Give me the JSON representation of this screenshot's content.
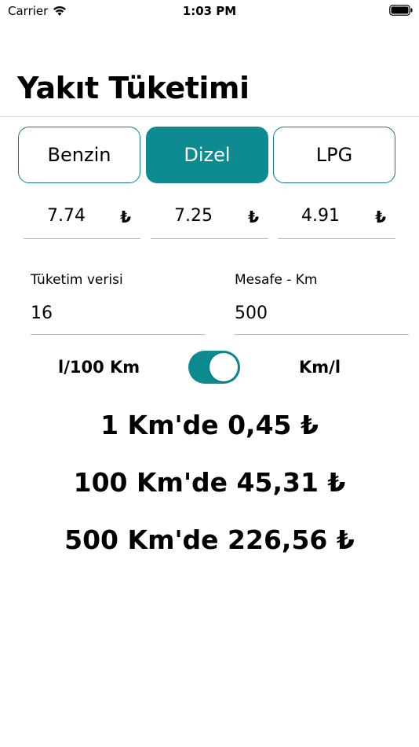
{
  "status": {
    "carrier": "Carrier",
    "time": "1:03 PM"
  },
  "header": {
    "title": "Yakıt Tüketimi"
  },
  "fuel_tabs": [
    {
      "label": "Benzin",
      "active": false
    },
    {
      "label": "Dizel",
      "active": true
    },
    {
      "label": "LPG",
      "active": false
    }
  ],
  "prices": [
    {
      "value": "7.74",
      "currency": "₺"
    },
    {
      "value": "7.25",
      "currency": "₺"
    },
    {
      "value": "4.91",
      "currency": "₺"
    }
  ],
  "consumption": {
    "label": "Tüketim verisi",
    "value": "16"
  },
  "distance": {
    "label": "Mesafe - Km",
    "value": "500"
  },
  "unit_toggle": {
    "left_label": "l/100 Km",
    "right_label": "Km/l",
    "on": true
  },
  "results": [
    "1 Km'de 0,45 ₺",
    "100 Km'de 45,31 ₺",
    "500 Km'de 226,56 ₺"
  ],
  "colors": {
    "accent": "#0e8a91",
    "underline": "#8fc9d1"
  }
}
